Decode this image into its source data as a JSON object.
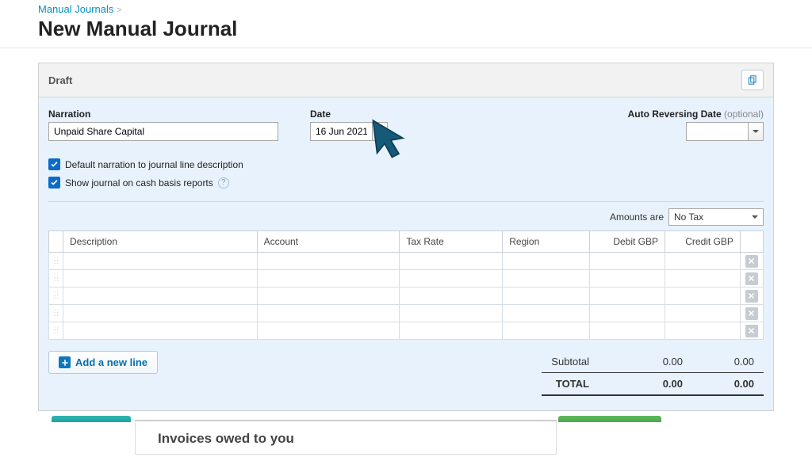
{
  "breadcrumb": {
    "parent": "Manual Journals",
    "sep": ">"
  },
  "page_title": "New Manual Journal",
  "card_title": "Draft",
  "labels": {
    "narration": "Narration",
    "date": "Date",
    "auto_reverse": "Auto Reversing Date",
    "optional": "(optional)",
    "amounts_are": "Amounts are",
    "add_line": "Add a new line",
    "subtotal": "Subtotal",
    "total": "TOTAL"
  },
  "values": {
    "narration": "Unpaid Share Capital",
    "date": "16 Jun 2021",
    "auto_reverse": "",
    "amounts_are": "No Tax",
    "subtotal_debit": "0.00",
    "subtotal_credit": "0.00",
    "total_debit": "0.00",
    "total_credit": "0.00"
  },
  "options": {
    "default_narration": "Default narration to journal line description",
    "show_cash_basis": "Show journal on cash basis reports"
  },
  "columns": {
    "description": "Description",
    "account": "Account",
    "tax_rate": "Tax Rate",
    "region": "Region",
    "debit": "Debit GBP",
    "credit": "Credit GBP"
  },
  "bottom_panel": "Invoices owed to you"
}
